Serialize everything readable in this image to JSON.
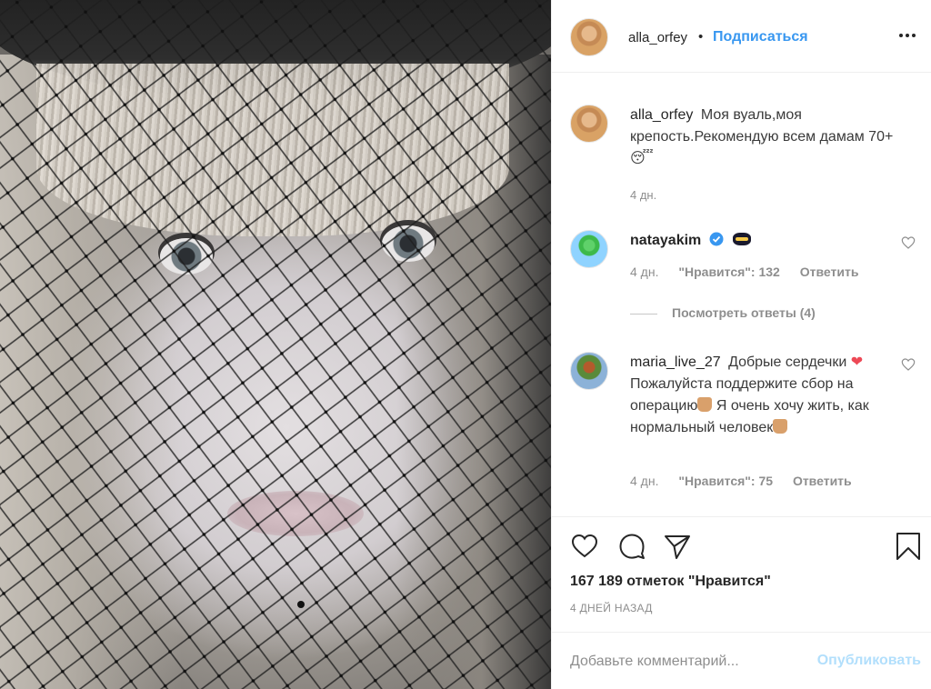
{
  "header": {
    "username": "alla_orfey",
    "separator": "•",
    "follow_label": "Подписаться"
  },
  "caption": {
    "username": "alla_orfey",
    "text": "Моя вуаль,моя крепость.Рекомендую всем дамам 70+",
    "emoji": "😴",
    "time": "4 дн."
  },
  "comments": [
    {
      "username": "natayakim",
      "verified": true,
      "text": "",
      "time": "4 дн.",
      "likes": "\"Нравится\": 132",
      "reply_label": "Ответить",
      "view_replies": "Посмотреть ответы (4)"
    },
    {
      "username": "maria_live_27",
      "text_part1": "Добрые сердечки",
      "text_part2": "Пожалуйста поддержите сбор на операцию",
      "text_part3": "Я очень хочу жить, как нормальный человек",
      "time": "4 дн.",
      "likes": "\"Нравится\": 75",
      "reply_label": "Ответить"
    }
  ],
  "actions": {
    "likes_count": "167 189 отметок \"Нравится\"",
    "post_time": "4 ДНЕЙ НАЗАД"
  },
  "add_comment": {
    "placeholder": "Добавьте комментарий...",
    "publish_label": "Опубликовать"
  },
  "colors": {
    "link_blue": "#3897f0",
    "publish_disabled": "#b2dffc",
    "muted": "#8e8e8e",
    "heart_red": "#ed4956"
  }
}
